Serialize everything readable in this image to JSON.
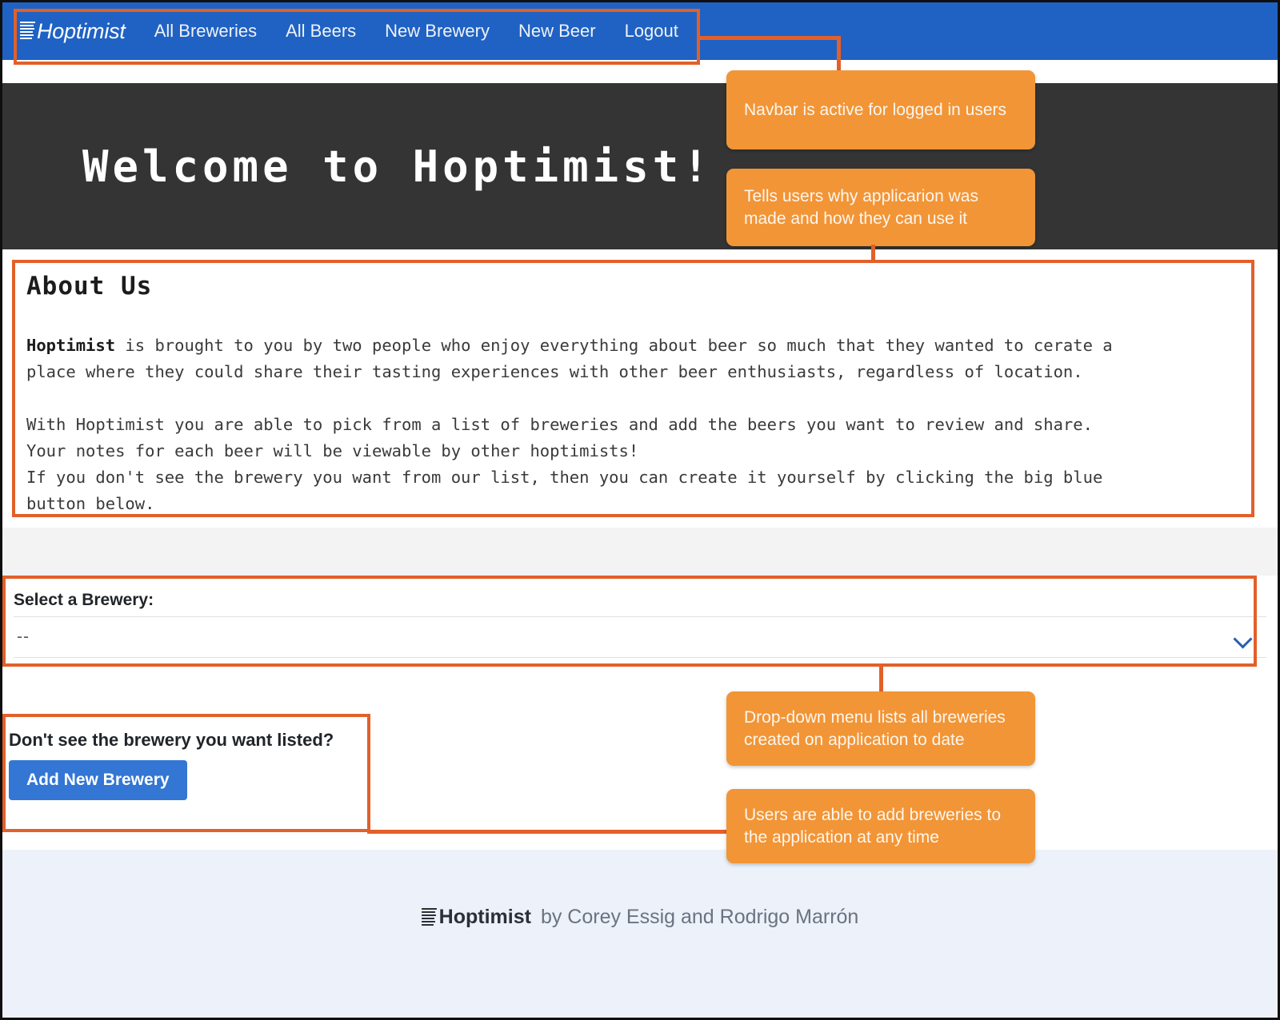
{
  "navbar": {
    "brand": "Hoptimist",
    "brand_icon": "stacked-lines-icon",
    "background_color": "#1f62c4",
    "links": [
      {
        "label": "All Breweries"
      },
      {
        "label": "All Beers"
      },
      {
        "label": "New Brewery"
      },
      {
        "label": "New Beer"
      },
      {
        "label": "Logout"
      }
    ]
  },
  "hero": {
    "title": "Welcome to Hoptimist!",
    "background_color": "#343434"
  },
  "about": {
    "heading": "About Us",
    "paragraph1_bold": "Hoptimist",
    "paragraph1_line1_rest": " is brought to you by two people who enjoy everything about beer so much that they wanted to cerate a",
    "paragraph1_line2": "place where they could share their tasting experiences with other beer enthusiasts, regardless of location.",
    "paragraph2_line1": "With Hoptimist you are able to pick from a list of breweries and add the beers you want to review and share.",
    "paragraph2_line2": "Your notes for each beer will be viewable by other hoptimists!",
    "paragraph2_line3": "If you don't see the brewery you want from our list, then you can create it yourself by clicking the big blue",
    "paragraph2_line4": "button below."
  },
  "brewery_select": {
    "label": "Select a Brewery:",
    "value": "--",
    "chevron_icon": "chevron-down-icon"
  },
  "add_brewery": {
    "question": "Don't see the brewery you want listed?",
    "button_label": "Add New Brewery",
    "button_color": "#3376d4"
  },
  "footer": {
    "icon": "stacked-lines-icon",
    "brand": "Hoptimist",
    "credit": "by Corey Essig and Rodrigo Marrón",
    "background_color": "#ecf1fa"
  },
  "annotations": {
    "highlight_color": "#e2602a",
    "callout_color": "#f29536",
    "callouts": [
      {
        "id": "navbar-note",
        "text": "Navbar is active for logged in users"
      },
      {
        "id": "about-note",
        "text": "Tells users why applicarion was made and how they can use it"
      },
      {
        "id": "dropdown-note",
        "text": "Drop-down menu lists all breweries created on application to date"
      },
      {
        "id": "add-brewery-note",
        "text": "Users are able to add breweries to the application at any time"
      }
    ]
  }
}
